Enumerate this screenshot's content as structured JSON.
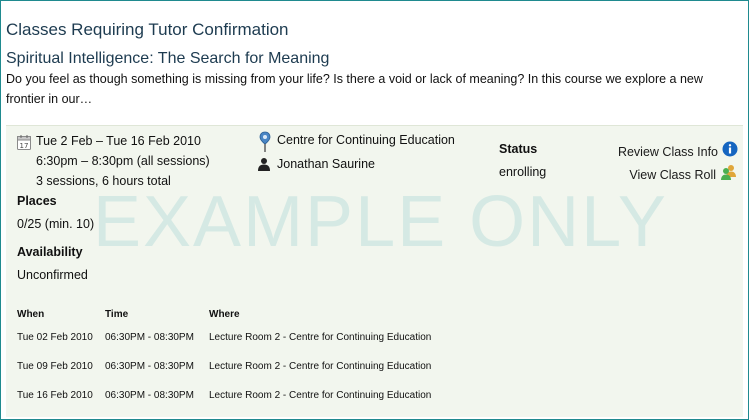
{
  "page_title": "Classes Requiring Tutor Confirmation",
  "course": {
    "title": "Spiritual Intelligence: The Search for Meaning",
    "description": "Do you feel as though something is missing from your life? Is there a void or lack of meaning? In this course we explore a new frontier in our…"
  },
  "watermark": "EXAMPLE ONLY",
  "class": {
    "date_range": "Tue 2 Feb – Tue 16 Feb 2010",
    "time_range": "6:30pm – 8:30pm (all sessions)",
    "sessions_summary": "3 sessions, 6 hours total",
    "location": "Centre for Continuing Education",
    "tutor": "Jonathan Saurine",
    "status_label": "Status",
    "status_value": "enrolling",
    "places_label": "Places",
    "places_value": "0/25 (min. 10)",
    "availability_label": "Availability",
    "availability_value": "Unconfirmed",
    "calendar_day": "17"
  },
  "actions": {
    "review": "Review Class Info",
    "roll": "View Class Roll"
  },
  "sessions_table": {
    "headers": [
      "When",
      "Time",
      "Where"
    ],
    "rows": [
      [
        "Tue 02 Feb 2010",
        "06:30PM - 08:30PM",
        "Lecture Room 2 - Centre for Continuing Education"
      ],
      [
        "Tue 09 Feb 2010",
        "06:30PM - 08:30PM",
        "Lecture Room 2 - Centre for Continuing Education"
      ],
      [
        "Tue 16 Feb 2010",
        "06:30PM - 08:30PM",
        "Lecture Room 2 - Centre for Continuing Education"
      ]
    ]
  },
  "colors": {
    "frame_border": "#1f8a8f",
    "heading": "#1d3b50",
    "panel_bg": "#f2f6ee",
    "info_icon": "#1565c0"
  }
}
